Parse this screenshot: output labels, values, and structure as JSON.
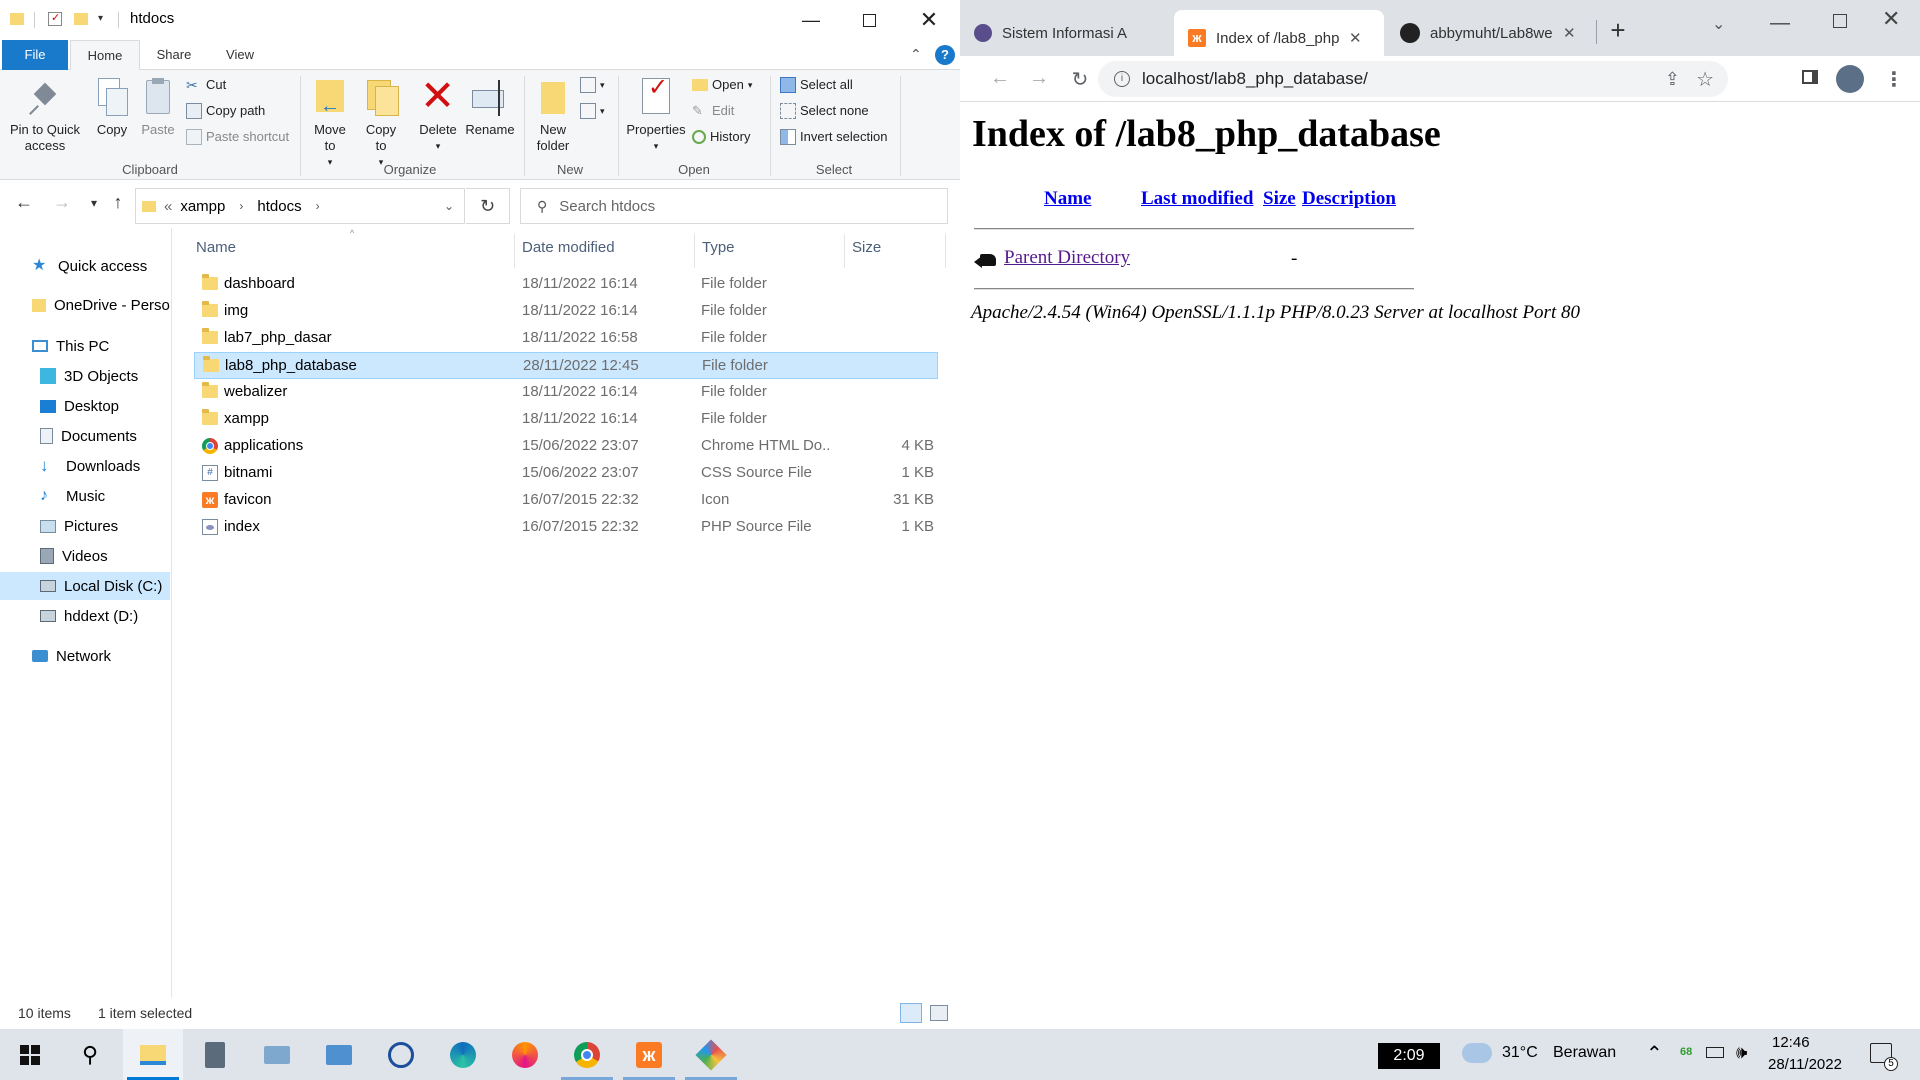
{
  "explorer": {
    "title": "htdocs",
    "ribbon_tabs": [
      "File",
      "Home",
      "Share",
      "View"
    ],
    "clipboard": {
      "pin_label": "Pin to Quick access",
      "copy_label": "Copy",
      "paste_label": "Paste",
      "cut_label": "Cut",
      "copy_path_label": "Copy path",
      "paste_shortcut_label": "Paste shortcut",
      "group_label": "Clipboard"
    },
    "organize": {
      "move_to_label": "Move to",
      "copy_to_label": "Copy to",
      "delete_label": "Delete",
      "rename_label": "Rename",
      "group_label": "Organize"
    },
    "new": {
      "new_folder_label": "New folder",
      "group_label": "New"
    },
    "open": {
      "properties_label": "Properties",
      "open_label": "Open",
      "edit_label": "Edit",
      "history_label": "History",
      "group_label": "Open"
    },
    "select": {
      "select_all_label": "Select all",
      "select_none_label": "Select none",
      "invert_label": "Invert selection",
      "group_label": "Select"
    },
    "address": {
      "overflow": "«",
      "crumbs": [
        "xampp",
        "htdocs"
      ]
    },
    "search_placeholder": "Search htdocs",
    "nav": {
      "quick_access": "Quick access",
      "onedrive": "OneDrive - Persor",
      "this_pc": "This PC",
      "objects3d": "3D Objects",
      "desktop": "Desktop",
      "documents": "Documents",
      "downloads": "Downloads",
      "music": "Music",
      "pictures": "Pictures",
      "videos": "Videos",
      "local_disk": "Local Disk (C:)",
      "hddext": "hddext (D:)",
      "network": "Network"
    },
    "columns": {
      "name": "Name",
      "date": "Date modified",
      "type": "Type",
      "size": "Size"
    },
    "files": [
      {
        "name": "dashboard",
        "date": "18/11/2022 16:14",
        "type": "File folder",
        "size": ""
      },
      {
        "name": "img",
        "date": "18/11/2022 16:14",
        "type": "File folder",
        "size": ""
      },
      {
        "name": "lab7_php_dasar",
        "date": "18/11/2022 16:58",
        "type": "File folder",
        "size": ""
      },
      {
        "name": "lab8_php_database",
        "date": "28/11/2022 12:45",
        "type": "File folder",
        "size": ""
      },
      {
        "name": "webalizer",
        "date": "18/11/2022 16:14",
        "type": "File folder",
        "size": ""
      },
      {
        "name": "xampp",
        "date": "18/11/2022 16:14",
        "type": "File folder",
        "size": ""
      },
      {
        "name": "applications",
        "date": "15/06/2022 23:07",
        "type": "Chrome HTML Do...",
        "size": "4 KB"
      },
      {
        "name": "bitnami",
        "date": "15/06/2022 23:07",
        "type": "CSS Source File",
        "size": "1 KB"
      },
      {
        "name": "favicon",
        "date": "16/07/2015 22:32",
        "type": "Icon",
        "size": "31 KB"
      },
      {
        "name": "index",
        "date": "16/07/2015 22:32",
        "type": "PHP Source File",
        "size": "1 KB"
      }
    ],
    "status": {
      "count": "10 items",
      "selected": "1 item selected"
    }
  },
  "chrome": {
    "tabs": [
      {
        "title": "Sistem Informasi A"
      },
      {
        "title": "Index of /lab8_php"
      },
      {
        "title": "abbymuht/Lab8we"
      }
    ],
    "url": "localhost/lab8_php_database/",
    "page": {
      "heading": "Index of /lab8_php_database",
      "col_name": "Name",
      "col_modified": "Last modified",
      "col_size": "Size",
      "col_description": "Description",
      "parent_link": "Parent Directory",
      "parent_size": "-",
      "server_signature": "Apache/2.4.54 (Win64) OpenSSL/1.1.1p PHP/8.0.23 Server at localhost Port 80"
    }
  },
  "taskbar": {
    "timer": "2:09",
    "weather_temp": "31°C",
    "weather_desc": "Berawan",
    "battery_badge": "68",
    "time": "12:46",
    "date": "28/11/2022",
    "notification_count": "5"
  }
}
